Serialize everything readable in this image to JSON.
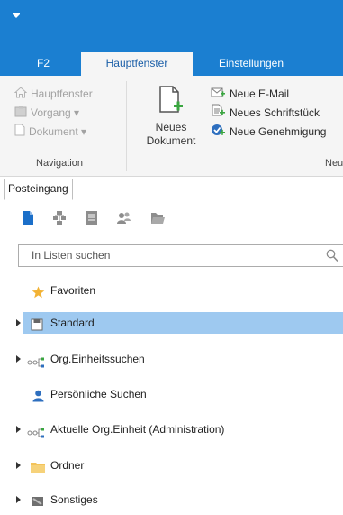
{
  "ribbon_tabs": [
    {
      "label": "F2"
    },
    {
      "label": "Hauptfenster"
    },
    {
      "label": "Einstellungen"
    }
  ],
  "navigation": {
    "items": [
      {
        "label": "Hauptfenster",
        "icon": "home-icon"
      },
      {
        "label": "Vorgang ▾",
        "icon": "vorgang-icon"
      },
      {
        "label": "Dokument ▾",
        "icon": "document-icon"
      }
    ],
    "group_label": "Navigation"
  },
  "new_group": {
    "big_button_label_line1": "Neues",
    "big_button_label_line2": "Dokument",
    "items": [
      {
        "label": "Neue E-Mail",
        "icon": "new-email-icon"
      },
      {
        "label": "Neues Schriftstück",
        "icon": "new-document-piece-icon"
      },
      {
        "label": "Neue Genehmigung",
        "icon": "new-approval-icon"
      }
    ],
    "group_label": "Neu"
  },
  "panel_tab": {
    "label": "Posteingang"
  },
  "search": {
    "placeholder": "In Listen suchen"
  },
  "tree": [
    {
      "label": "Favoriten",
      "icon": "star-icon",
      "expandable": false,
      "selected": false
    },
    {
      "label": "Standard",
      "icon": "save-icon",
      "expandable": true,
      "selected": true
    },
    {
      "label": "Org.Einheitssuchen",
      "icon": "org-unit-icon",
      "expandable": true,
      "selected": false
    },
    {
      "label": "Persönliche Suchen",
      "icon": "person-icon",
      "expandable": false,
      "selected": false
    },
    {
      "label": "Aktuelle Org.Einheit (Administration)",
      "icon": "org-unit-icon",
      "expandable": true,
      "selected": false
    },
    {
      "label": "Ordner",
      "icon": "folder-icon",
      "expandable": true,
      "selected": false
    },
    {
      "label": "Sonstiges",
      "icon": "misc-icon",
      "expandable": true,
      "selected": false
    }
  ],
  "colors": {
    "accent": "#1b7fd1",
    "selection": "#9ec9f0",
    "disabled_text": "#a2a2a2"
  }
}
